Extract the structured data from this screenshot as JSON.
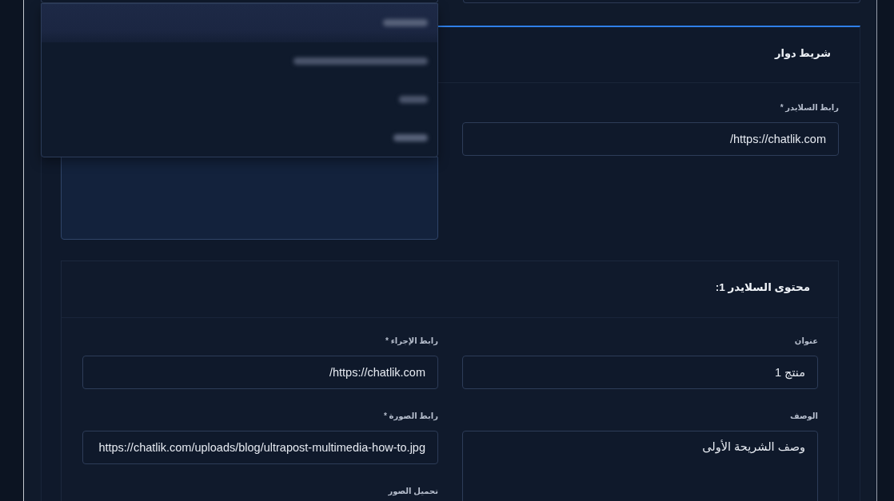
{
  "top_row": {
    "fields": [
      {
        "kind": "input"
      },
      {
        "kind": "select",
        "expanded": true,
        "options": [
          {
            "selected": true
          },
          {
            "selected": false
          },
          {
            "selected": false
          },
          {
            "selected": false
          }
        ]
      }
    ]
  },
  "slider_card": {
    "title": "شريط دوار",
    "fields": [
      {
        "kind": "input",
        "label": "رابط السلايدر *",
        "value": "https://chatlik.com/"
      },
      {
        "kind": "textarea",
        "focused": true
      }
    ],
    "slides": [
      {
        "title": "محتوى السلايدر 1:",
        "fields": [
          {
            "kind": "input",
            "label": "عنوان",
            "value": "منتج 1"
          },
          {
            "kind": "input",
            "label": "رابط الإجراء *",
            "value": "https://chatlik.com/"
          },
          {
            "kind": "textarea",
            "focused": false,
            "label": "الوصف",
            "value": "وصف الشريحة الأولى"
          },
          {
            "kind": "input",
            "label": "رابط الصورة *",
            "value": "https://chatlik.com/uploads/blog/ultrapost-multimedia-how-to.jpg"
          },
          {
            "kind": "upload",
            "label": "تحميل الصور"
          }
        ]
      }
    ]
  }
}
